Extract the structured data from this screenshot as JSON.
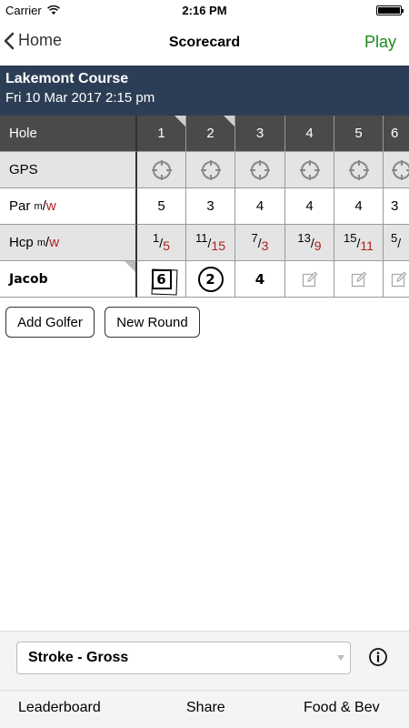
{
  "status_bar": {
    "carrier": "Carrier",
    "time": "2:16 PM"
  },
  "nav": {
    "back_label": "Home",
    "title": "Scorecard",
    "play_label": "Play"
  },
  "course": {
    "name": "Lakemont Course",
    "date": "Fri 10 Mar 2017 2:15 pm"
  },
  "scorecard": {
    "hole_label": "Hole",
    "gps_label": "GPS",
    "par_label": "Par",
    "hcp_label": "Hcp",
    "men_suffix": "m",
    "women_suffix": "w",
    "holes": [
      "1",
      "2",
      "3",
      "4",
      "5",
      "6"
    ],
    "par": [
      "5",
      "3",
      "4",
      "4",
      "4",
      "3"
    ],
    "hcp": [
      {
        "men": "1",
        "women": "5"
      },
      {
        "men": "11",
        "women": "15"
      },
      {
        "men": "7",
        "women": "3"
      },
      {
        "men": "13",
        "women": "9"
      },
      {
        "men": "15",
        "women": "11"
      },
      {
        "men": "5",
        "women": ""
      }
    ],
    "player": {
      "name": "Jacob",
      "scores": [
        "6",
        "2",
        "4",
        "",
        "",
        ""
      ]
    }
  },
  "actions": {
    "add_golfer": "Add Golfer",
    "new_round": "New Round"
  },
  "footer": {
    "game_type": "Stroke - Gross",
    "tabs": [
      "Leaderboard",
      "Share",
      "Food & Bev"
    ]
  },
  "colors": {
    "nav_play": "#1a8a1a",
    "course_header": "#2c3e55",
    "hole_row": "#4a4a4a",
    "women_red": "#b02020"
  }
}
